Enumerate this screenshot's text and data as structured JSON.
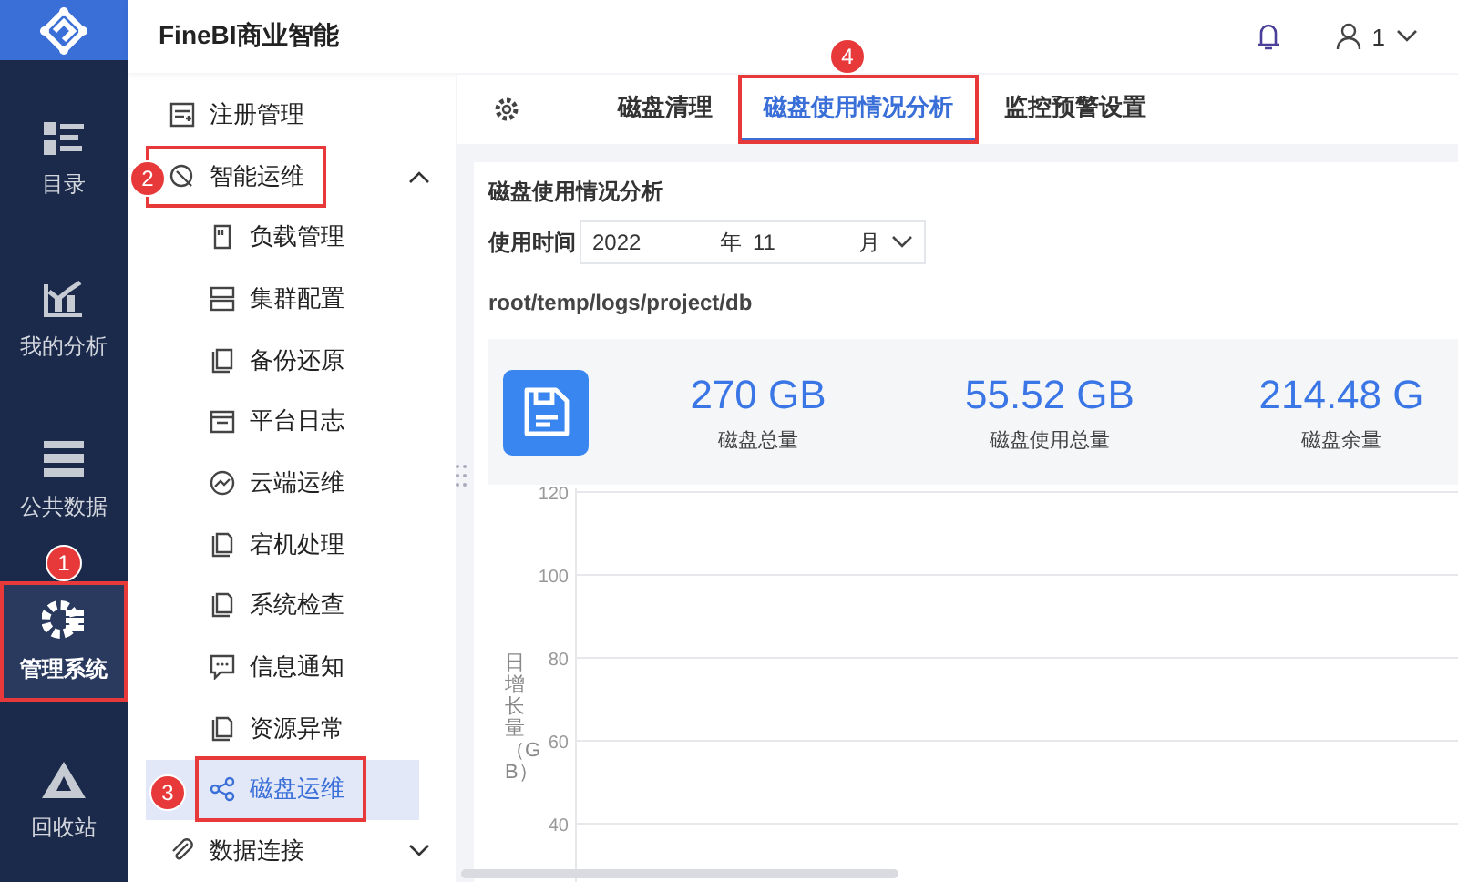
{
  "app": {
    "title": "FineBI商业智能",
    "user": "1"
  },
  "nav": [
    {
      "label": "目录",
      "selected": false,
      "highlighted": false
    },
    {
      "label": "我的分析",
      "selected": false,
      "highlighted": false
    },
    {
      "label": "公共数据",
      "selected": false,
      "highlighted": false
    },
    {
      "label": "管理系统",
      "selected": true,
      "highlighted": true,
      "callout": "1"
    },
    {
      "label": "回收站",
      "selected": false,
      "highlighted": false
    }
  ],
  "menu": [
    {
      "label": "注册管理",
      "highlighted": false
    },
    {
      "label": "智能运维",
      "expanded": true,
      "highlighted": true,
      "callout": "2",
      "children": [
        {
          "label": "负载管理",
          "selected": false,
          "highlighted": false
        },
        {
          "label": "集群配置",
          "selected": false,
          "highlighted": false
        },
        {
          "label": "备份还原",
          "selected": false,
          "highlighted": false
        },
        {
          "label": "平台日志",
          "selected": false,
          "highlighted": false
        },
        {
          "label": "云端运维",
          "selected": false,
          "highlighted": false
        },
        {
          "label": "宕机处理",
          "selected": false,
          "highlighted": false
        },
        {
          "label": "系统检查",
          "selected": false,
          "highlighted": false
        },
        {
          "label": "信息通知",
          "selected": false,
          "highlighted": false
        },
        {
          "label": "资源异常",
          "selected": false,
          "highlighted": false
        },
        {
          "label": "磁盘运维",
          "selected": true,
          "highlighted": true,
          "callout": "3"
        }
      ]
    },
    {
      "label": "数据连接",
      "expanded": false,
      "highlighted": false
    }
  ],
  "tabs": [
    {
      "label": "磁盘清理",
      "selected": false,
      "highlighted": false
    },
    {
      "label": "磁盘使用情况分析",
      "selected": true,
      "highlighted": true,
      "callout": "4"
    },
    {
      "label": "监控预警设置",
      "selected": false,
      "highlighted": false
    }
  ],
  "panel": {
    "title": "磁盘使用情况分析",
    "time_label": "使用时间",
    "year": "2022",
    "year_unit": "年",
    "month": "11",
    "month_unit": "月",
    "path": "root/temp/logs/project/db",
    "stats": [
      {
        "value": "270 GB",
        "label": "磁盘总量"
      },
      {
        "value": "55.52 GB",
        "label": "磁盘使用总量"
      },
      {
        "value": "214.48 G",
        "label": "磁盘余量"
      }
    ],
    "chart_axis": {
      "title": "日增长量（GB）",
      "tick_labels": [
        "120",
        "100",
        "80",
        "60",
        "40"
      ]
    }
  }
}
